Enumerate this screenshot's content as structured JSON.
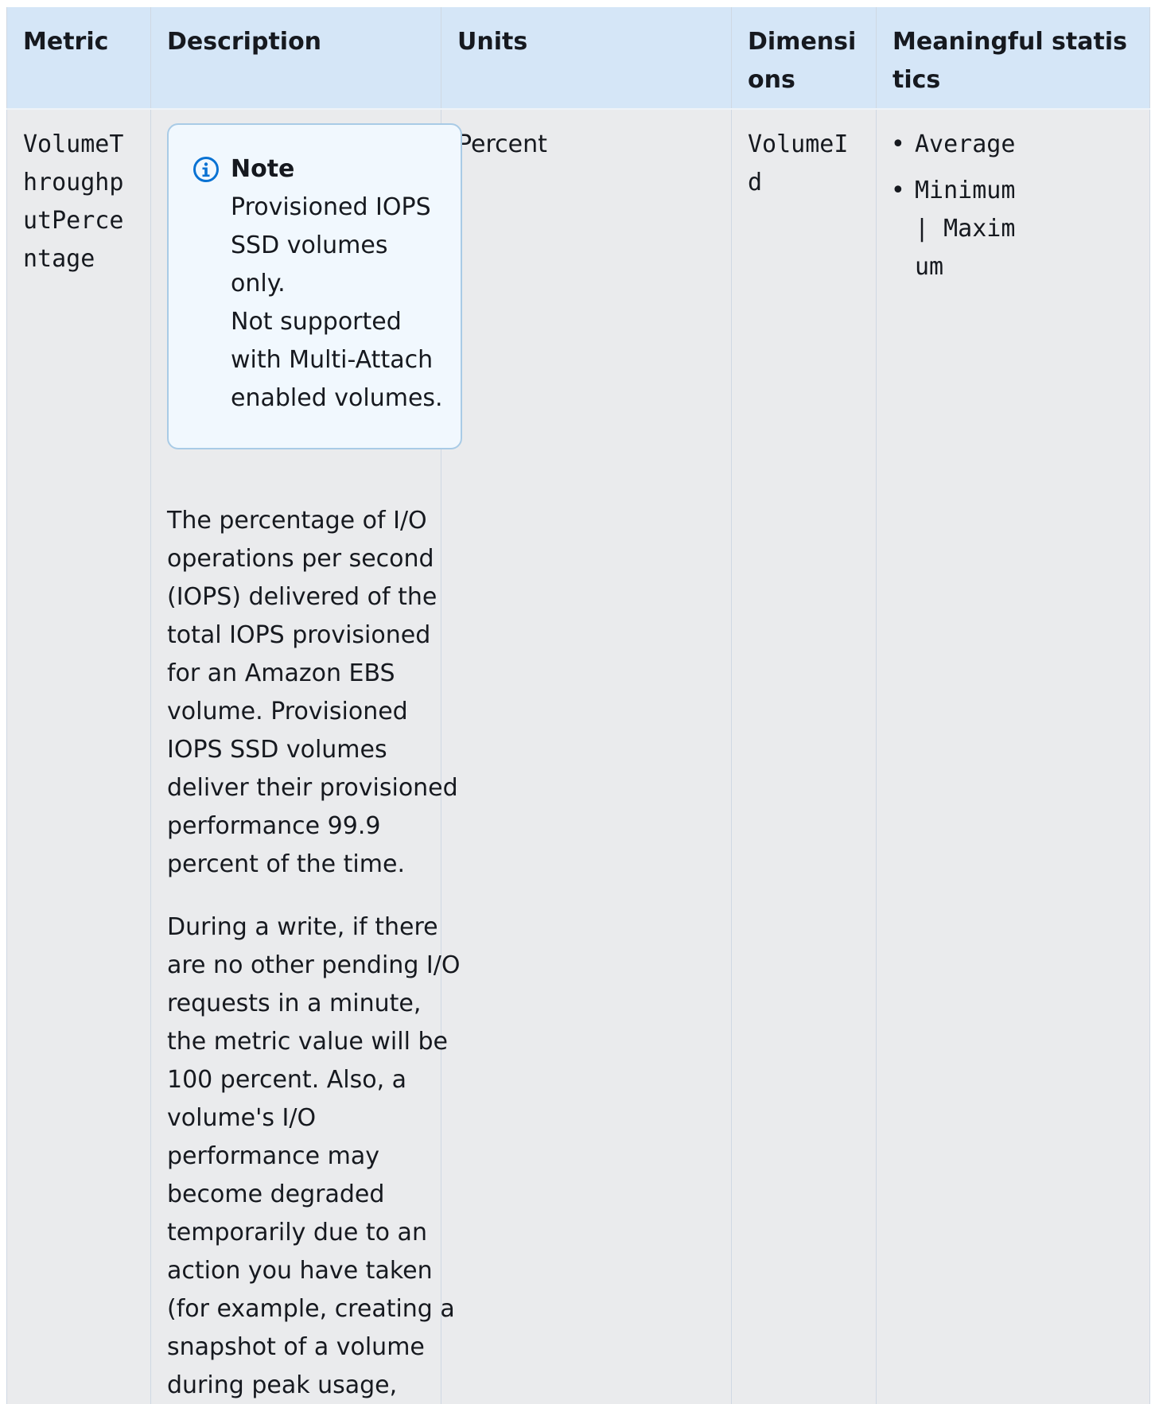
{
  "table": {
    "headers": {
      "metric": "Metric",
      "description": "Description",
      "units": "Units",
      "dimensions": "Dimensions",
      "statistics": "Meaningful statistics"
    },
    "row": {
      "metric": "VolumeThroughputPercentage",
      "note": {
        "title": "Note",
        "line1": "Provisioned IOPS SSD volumes only.",
        "line2": "Not supported with Multi-Attach enabled volumes.",
        "icon": "info-icon",
        "accent_color": "#0972d3"
      },
      "description_paragraphs": [
        "The percentage of I/O operations per second (IOPS) delivered of the total IOPS provisioned for an Amazon EBS volume. Provisioned IOPS SSD volumes deliver their provisioned performance 99.9 percent of the time.",
        "During a write, if there are no other pending I/O requests in a minute, the metric value will be 100 percent. Also, a volume's I/O performance may become degraded temporarily due to an action you have taken (for example, creating a snapshot of a volume during peak usage, running the volume on"
      ],
      "units": "Percent",
      "dimensions": "VolumeId",
      "statistics": [
        "Average",
        "Minimum | Maximum"
      ]
    }
  },
  "colors": {
    "header_bg": "#d5e6f7",
    "row_bg": "#eaebed",
    "note_bg": "#f1f8fe",
    "note_border": "#a9cbe6"
  }
}
